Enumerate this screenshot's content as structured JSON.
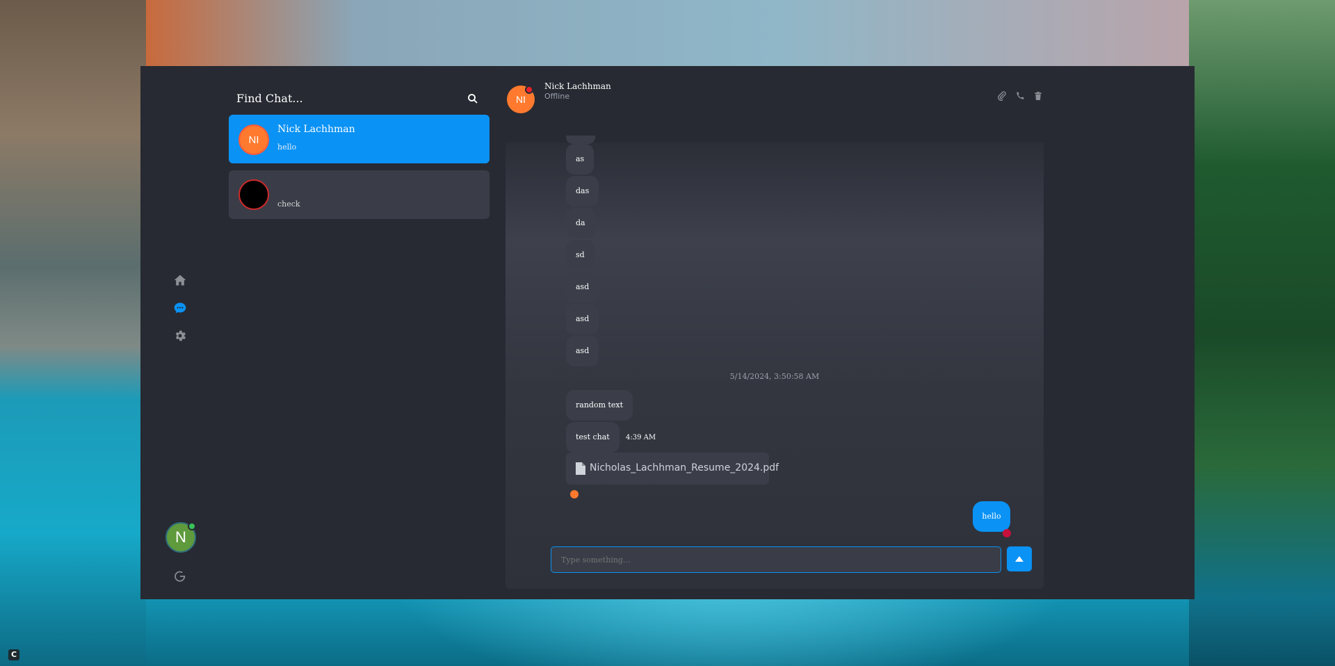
{
  "sidebar_nav": {
    "items": [
      {
        "name": "home",
        "icon": "home-icon",
        "active": false
      },
      {
        "name": "chat",
        "icon": "chat-icon",
        "active": true
      },
      {
        "name": "settings",
        "icon": "gear-icon",
        "active": false
      }
    ],
    "user_avatar_initial": "N",
    "logout_icon": "logout-icon"
  },
  "chat_list": {
    "title": "Find Chat...",
    "search_icon": "search-icon",
    "chats": [
      {
        "initials": "NI",
        "name": "Nick Lachhman",
        "preview": "hello",
        "active": true
      },
      {
        "initials": "",
        "name": "",
        "preview": "check",
        "active": false
      }
    ]
  },
  "chat_header": {
    "initials": "NI",
    "name": "Nick Lachhman",
    "status": "Offline",
    "actions": [
      "paperclip-icon",
      "phone-icon",
      "trash-icon"
    ]
  },
  "messages": {
    "incoming": [
      "as",
      "das",
      "da",
      "sd",
      "asd",
      "asd",
      "asd"
    ],
    "timestamp": "5/14/2024, 3:50:58 AM",
    "incoming_2": [
      "random text",
      "test chat"
    ],
    "inline_time": "4:39 AM",
    "file_name": "Nicholas_Lachhman_Resume_2024.pdf",
    "outgoing": "hello"
  },
  "composer": {
    "placeholder": "Type something..."
  },
  "colors": {
    "accent": "#0a92f5",
    "avatar_orange": "#ff7a2e",
    "online": "#39c25a",
    "offline": "#e8212c"
  }
}
